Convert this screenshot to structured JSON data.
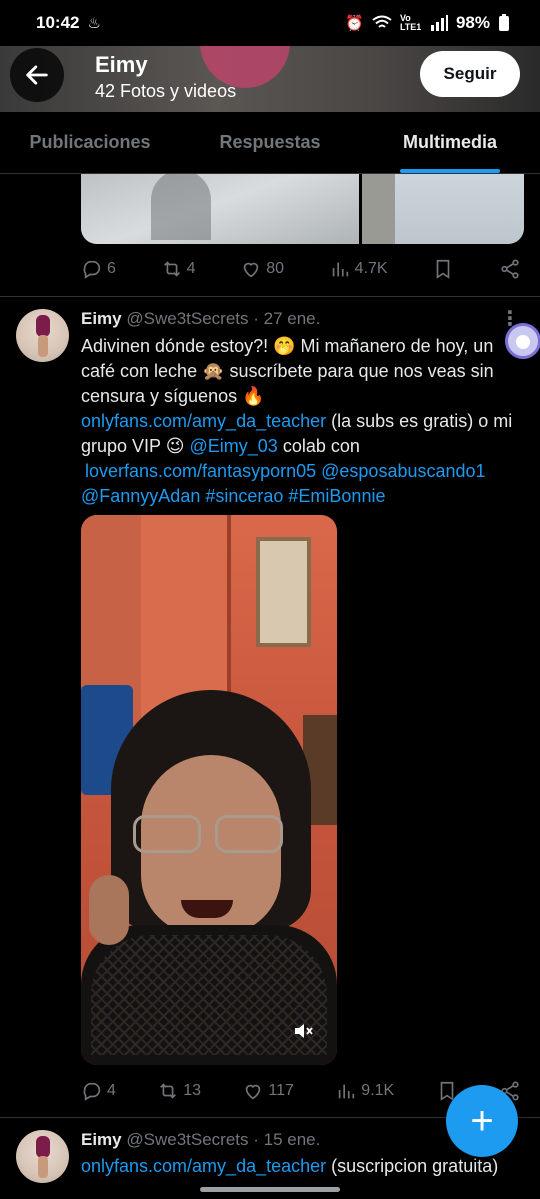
{
  "status_bar": {
    "time": "10:42",
    "time_icon": "notification-icon",
    "signal_label": "Vo LTE1",
    "battery": "98%"
  },
  "header": {
    "title": "Eimy",
    "subtitle": "42 Fotos y videos",
    "follow_label": "Seguir"
  },
  "tabs": [
    {
      "label": "Publicaciones",
      "active": false
    },
    {
      "label": "Respuestas",
      "active": false
    },
    {
      "label": "Multimedia",
      "active": true
    }
  ],
  "tweet1": {
    "replies": "6",
    "retweets": "4",
    "likes": "80",
    "views": "4.7K"
  },
  "tweet2": {
    "name": "Eimy",
    "handle": "@Swe3tSecrets",
    "date": "· 27 ene.",
    "text_part1": "Adivinen dónde estoy?! 🤭 Mi mañanero de hoy, un café con leche 🙊 suscríbete para que nos veas sin censura y síguenos 🔥",
    "link1": "onlyfans.com/amy_da_teacher",
    "text_part2": " (la subs es gratis) o mi grupo VIP 😉 ",
    "mention1": "@Eimy_03",
    "text_part3": " colab con ",
    "link2": "loverfans.com/fantasyporn05",
    "mention2": " @esposabuscando1",
    "mention3": "@FannyyAdan",
    "hashtag1": " #sincerao",
    "hashtag2": " #EmiBonnie",
    "replies": "4",
    "retweets": "13",
    "likes": "117",
    "views": "9.1K"
  },
  "tweet3": {
    "name": "Eimy",
    "handle": "@Swe3tSecrets",
    "date": "· 15 ene.",
    "link": "onlyfans.com/amy_da_teacher",
    "text": " (suscripcion gratuita)"
  },
  "fab_label": "+"
}
